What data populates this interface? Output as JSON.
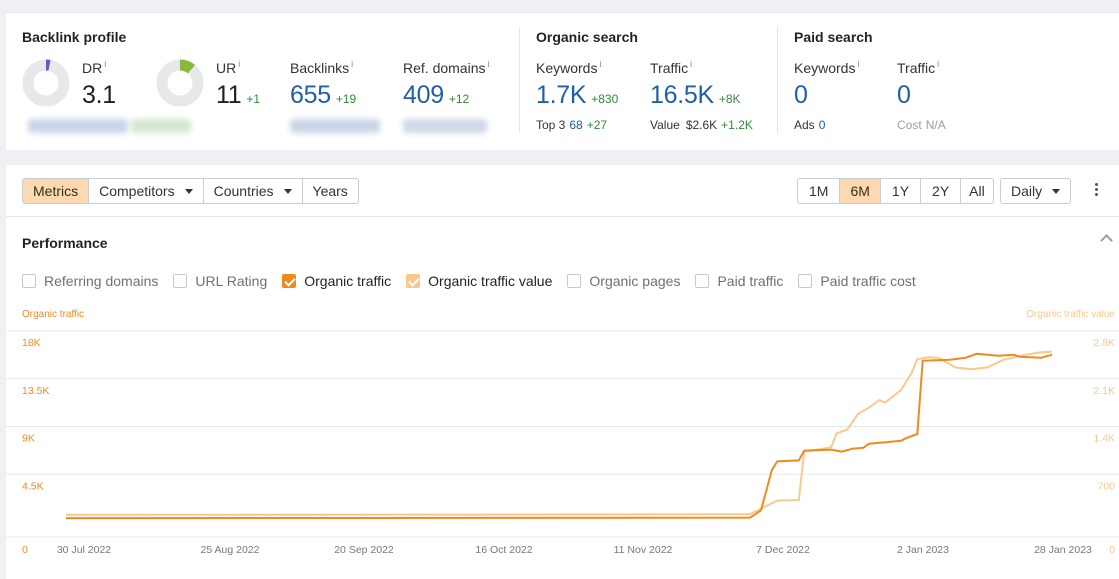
{
  "backlink_profile": {
    "title": "Backlink profile",
    "dr": {
      "label": "DR",
      "info": "i",
      "value": "3.1",
      "level_pct": 3.1
    },
    "ur": {
      "label": "UR",
      "info": "i",
      "value": "11",
      "delta": "+1",
      "level_pct": 11
    },
    "backlinks": {
      "label": "Backlinks",
      "info": "i",
      "value": "655",
      "delta": "+19"
    },
    "ref_domains": {
      "label": "Ref. domains",
      "info": "i",
      "value": "409",
      "delta": "+12"
    }
  },
  "organic_search": {
    "title": "Organic search",
    "keywords": {
      "label": "Keywords",
      "info": "i",
      "value": "1.7K",
      "delta": "+830",
      "sub_label": "Top 3",
      "sub_value": "68",
      "sub_delta": "+27"
    },
    "traffic": {
      "label": "Traffic",
      "info": "i",
      "value": "16.5K",
      "delta": "+8K",
      "sub_label": "Value",
      "sub_value": "$2.6K",
      "sub_delta": "+1.2K"
    }
  },
  "paid_search": {
    "title": "Paid search",
    "keywords": {
      "label": "Keywords",
      "info": "i",
      "value": "0",
      "sub_label": "Ads",
      "sub_value": "0"
    },
    "traffic": {
      "label": "Traffic",
      "info": "i",
      "value": "0",
      "sub_label": "Cost",
      "sub_value": "N/A"
    }
  },
  "toolbar": {
    "tabs": [
      "Metrics",
      "Competitors",
      "Countries",
      "Years"
    ],
    "active_tab": "Metrics",
    "ranges": [
      "1M",
      "6M",
      "1Y",
      "2Y",
      "All"
    ],
    "active_range": "6M",
    "interval": "Daily"
  },
  "performance": {
    "title": "Performance",
    "checkboxes": [
      {
        "label": "Referring domains",
        "checked": false
      },
      {
        "label": "URL Rating",
        "checked": false
      },
      {
        "label": "Organic traffic",
        "checked": true,
        "color": "#f08a1c"
      },
      {
        "label": "Organic traffic value",
        "checked": true,
        "color": "#fbc88c"
      },
      {
        "label": "Organic pages",
        "checked": false
      },
      {
        "label": "Paid traffic",
        "checked": false
      },
      {
        "label": "Paid traffic cost",
        "checked": false
      }
    ]
  },
  "colors": {
    "accent": "#f08a1c",
    "accent_light": "#fbc88c",
    "blue": "#1f5fa8",
    "green": "#2f8a3a"
  },
  "chart_data": {
    "type": "line",
    "left_axis_label": "Organic traffic",
    "right_axis_label": "Organic traffic value",
    "left_ticks": [
      "0",
      "4.5K",
      "9K",
      "13.5K",
      "18K"
    ],
    "right_ticks": [
      "0",
      "700",
      "1.4K",
      "2.1K",
      "2.8K"
    ],
    "ylim_left": [
      0,
      20000
    ],
    "ylim_right": [
      0,
      3111
    ],
    "x_ticks": [
      "30 Jul 2022",
      "25 Aug 2022",
      "20 Sep 2022",
      "16 Oct 2022",
      "11 Nov 2022",
      "7 Dec 2022",
      "2 Jan 2023",
      "28 Jan 2023"
    ],
    "x_range": [
      "2022-07-30",
      "2023-01-29"
    ],
    "grid": true,
    "series": [
      {
        "name": "Organic traffic",
        "axis": "left",
        "color": "#f08a1c",
        "points": [
          [
            "2022-07-30",
            400
          ],
          [
            "2022-10-16",
            420
          ],
          [
            "2022-12-04",
            450
          ],
          [
            "2022-12-06",
            1200
          ],
          [
            "2022-12-08",
            5300
          ],
          [
            "2022-12-09",
            6200
          ],
          [
            "2022-12-13",
            6300
          ],
          [
            "2022-12-14",
            7300
          ],
          [
            "2022-12-19",
            7400
          ],
          [
            "2022-12-21",
            7200
          ],
          [
            "2022-12-23",
            7500
          ],
          [
            "2022-12-25",
            7600
          ],
          [
            "2022-12-26",
            8000
          ],
          [
            "2022-12-28",
            8100
          ],
          [
            "2022-12-30",
            8200
          ],
          [
            "2023-01-01",
            8300
          ],
          [
            "2023-01-02",
            8600
          ],
          [
            "2023-01-04",
            9000
          ],
          [
            "2023-01-05",
            16500
          ],
          [
            "2023-01-10",
            16600
          ],
          [
            "2023-01-13",
            16800
          ],
          [
            "2023-01-15",
            17200
          ],
          [
            "2023-01-19",
            17000
          ],
          [
            "2023-01-22",
            17100
          ],
          [
            "2023-01-23",
            16900
          ],
          [
            "2023-01-27",
            16800
          ],
          [
            "2023-01-29",
            17100
          ]
        ]
      },
      {
        "name": "Organic traffic value",
        "axis": "right",
        "color": "#fbc88c",
        "points": [
          [
            "2022-07-30",
            115
          ],
          [
            "2022-10-16",
            118
          ],
          [
            "2022-12-04",
            125
          ],
          [
            "2022-12-06",
            215
          ],
          [
            "2022-12-09",
            340
          ],
          [
            "2022-12-13",
            350
          ],
          [
            "2022-12-14",
            1120
          ],
          [
            "2022-12-17",
            1160
          ],
          [
            "2022-12-19",
            1190
          ],
          [
            "2022-12-20",
            1410
          ],
          [
            "2022-12-22",
            1470
          ],
          [
            "2022-12-24",
            1720
          ],
          [
            "2022-12-26",
            1820
          ],
          [
            "2022-12-28",
            1940
          ],
          [
            "2022-12-29",
            1900
          ],
          [
            "2023-01-01",
            2100
          ],
          [
            "2023-01-03",
            2380
          ],
          [
            "2023-01-04",
            2590
          ],
          [
            "2023-01-06",
            2620
          ],
          [
            "2023-01-08",
            2610
          ],
          [
            "2023-01-11",
            2460
          ],
          [
            "2023-01-14",
            2430
          ],
          [
            "2023-01-17",
            2460
          ],
          [
            "2023-01-20",
            2580
          ],
          [
            "2023-01-22",
            2620
          ],
          [
            "2023-01-24",
            2660
          ],
          [
            "2023-01-27",
            2700
          ],
          [
            "2023-01-29",
            2710
          ]
        ]
      }
    ]
  }
}
